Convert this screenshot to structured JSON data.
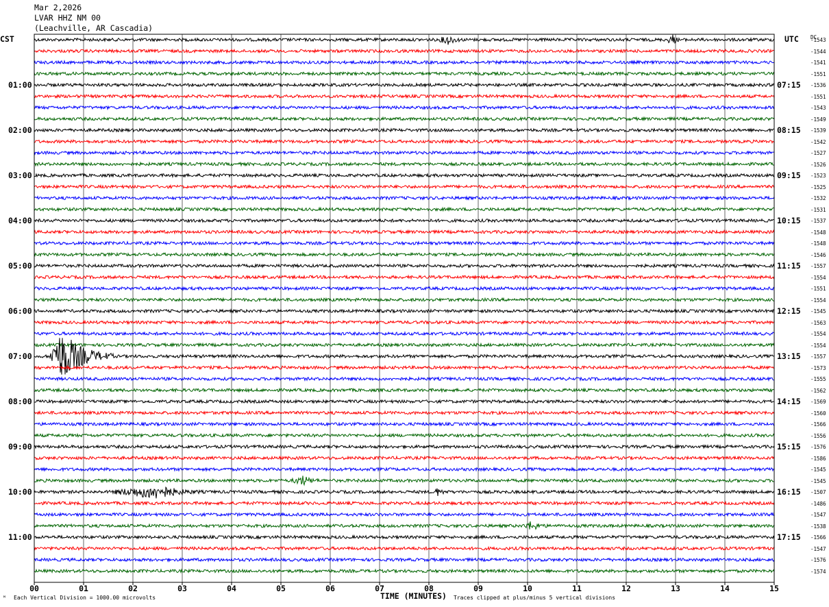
{
  "header": {
    "date": "Mar 2,2026",
    "station": "LVAR HHZ NM 00",
    "location": "(Leachville, AR Cascadia)"
  },
  "left_tz": "CST",
  "right_tz": "UTC",
  "dc_label": "DC",
  "footer": {
    "scale_note": "Each Vertical Division = 1000.00 microvolts",
    "clip_note": "Traces clipped at plus/minus 5 vertical divisions",
    "corner_mark": "ᴹ"
  },
  "chart_data": {
    "type": "line",
    "xlabel": "TIME (MINUTES)",
    "xlim": [
      0,
      15
    ],
    "x_ticks": [
      "00",
      "01",
      "02",
      "03",
      "04",
      "05",
      "06",
      "07",
      "08",
      "09",
      "10",
      "11",
      "12",
      "13",
      "14",
      "15"
    ],
    "trace_colors": [
      "#000000",
      "#ff0000",
      "#0000ff",
      "#006400"
    ],
    "traces_per_hour": 4,
    "hour_labels_local": [
      "01:00",
      "02:00",
      "03:00",
      "04:00",
      "05:00",
      "06:00",
      "07:00",
      "08:00",
      "09:00",
      "10:00",
      "11:00"
    ],
    "hour_labels_utc": [
      "07:15",
      "08:15",
      "09:15",
      "10:15",
      "11:15",
      "12:15",
      "13:15",
      "14:15",
      "15:15",
      "16:15",
      "17:15"
    ],
    "dc_offsets": [
      -1543,
      -1544,
      -1541,
      -1551,
      -1536,
      -1551,
      -1543,
      -1549,
      -1539,
      -1542,
      -1527,
      -1526,
      -1523,
      -1525,
      -1532,
      -1531,
      -1537,
      -1548,
      -1548,
      -1546,
      -1557,
      -1554,
      -1551,
      -1554,
      -1545,
      -1563,
      -1554,
      -1554,
      -1557,
      -1573,
      -1555,
      -1562,
      -1569,
      -1560,
      -1566,
      -1556,
      -1576,
      -1586,
      -1545,
      -1545,
      -1507,
      -1486,
      -1547,
      -1538,
      -1566,
      -1547,
      -1576,
      -1574
    ],
    "events": [
      {
        "trace": 28,
        "start_minute": 0.3,
        "peak_minute": 0.55,
        "end_minute": 1.6,
        "amplitude": "large"
      },
      {
        "trace": 40,
        "start_minute": 1.5,
        "peak_minute": 2.55,
        "end_minute": 3.4,
        "amplitude": "moderate"
      },
      {
        "trace": 40,
        "start_minute": 8.1,
        "peak_minute": 8.15,
        "end_minute": 8.4,
        "amplitude": "small"
      },
      {
        "trace": 0,
        "start_minute": 8.2,
        "peak_minute": 8.4,
        "end_minute": 8.7,
        "amplitude": "small"
      },
      {
        "trace": 0,
        "start_minute": 12.8,
        "peak_minute": 12.95,
        "end_minute": 13.1,
        "amplitude": "small"
      },
      {
        "trace": 39,
        "start_minute": 5.2,
        "peak_minute": 5.45,
        "end_minute": 5.8,
        "amplitude": "small"
      },
      {
        "trace": 43,
        "start_minute": 9.9,
        "peak_minute": 10.1,
        "end_minute": 10.4,
        "amplitude": "small"
      }
    ]
  }
}
